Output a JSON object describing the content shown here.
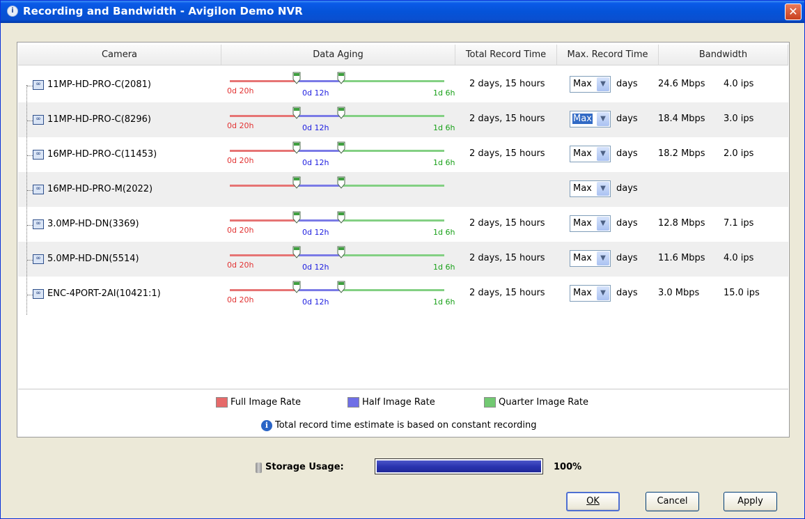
{
  "window": {
    "title": "Recording and Bandwidth - Avigilon Demo NVR",
    "title_icon": "info-circle-icon",
    "close_glyph": "✕"
  },
  "columns": {
    "camera": "Camera",
    "data_aging": "Data Aging",
    "total_record_time": "Total Record Time",
    "max_record_time": "Max. Record Time",
    "bandwidth": "Bandwidth"
  },
  "cameras": [
    {
      "name": "11MP-HD-PRO-C(2081)",
      "full": "0d 20h",
      "half": "0d 12h",
      "quarter": "1d 6h",
      "total": "2 days, 15 hours",
      "max": "Max",
      "days": "days",
      "bandwidth": "24.6 Mbps",
      "ips": "4.0 ips"
    },
    {
      "name": "11MP-HD-PRO-C(8296)",
      "full": "0d 20h",
      "half": "0d 12h",
      "quarter": "1d 6h",
      "total": "2 days, 15 hours",
      "max": "Max",
      "days": "days",
      "bandwidth": "18.4 Mbps",
      "ips": "3.0 ips"
    },
    {
      "name": "16MP-HD-PRO-C(11453)",
      "full": "0d 20h",
      "half": "0d 12h",
      "quarter": "1d 6h",
      "total": "2 days, 15 hours",
      "max": "Max",
      "days": "days",
      "bandwidth": "18.2 Mbps",
      "ips": "2.0 ips"
    },
    {
      "name": "16MP-HD-PRO-M(2022)",
      "full": "",
      "half": "",
      "quarter": "",
      "total": "",
      "max": "Max",
      "days": "days",
      "bandwidth": "",
      "ips": ""
    },
    {
      "name": "3.0MP-HD-DN(3369)",
      "full": "0d 20h",
      "half": "0d 12h",
      "quarter": "1d 6h",
      "total": "2 days, 15 hours",
      "max": "Max",
      "days": "days",
      "bandwidth": "12.8 Mbps",
      "ips": "7.1 ips"
    },
    {
      "name": "5.0MP-HD-DN(5514)",
      "full": "0d 20h",
      "half": "0d 12h",
      "quarter": "1d 6h",
      "total": "2 days, 15 hours",
      "max": "Max",
      "days": "days",
      "bandwidth": "11.6 Mbps",
      "ips": "4.0 ips"
    },
    {
      "name": "ENC-4PORT-2AI(10421:1)",
      "full": "0d 20h",
      "half": "0d 12h",
      "quarter": "1d 6h",
      "total": "2 days, 15 hours",
      "max": "Max",
      "days": "days",
      "bandwidth": "3.0 Mbps",
      "ips": "15.0 ips"
    }
  ],
  "legend": {
    "full": "Full Image Rate",
    "half": "Half Image Rate",
    "quarter": "Quarter Image Rate",
    "note": "Total record time estimate is based on constant recording"
  },
  "storage": {
    "label": "Storage Usage:",
    "value_text": "100%",
    "fraction": 1.0
  },
  "buttons": {
    "ok": "OK",
    "cancel": "Cancel",
    "apply": "Apply"
  },
  "colors": {
    "full_rate": "#e66a6a",
    "half_rate": "#6f6fe6",
    "quarter_rate": "#72c972",
    "thumb": "#3fa03f"
  }
}
